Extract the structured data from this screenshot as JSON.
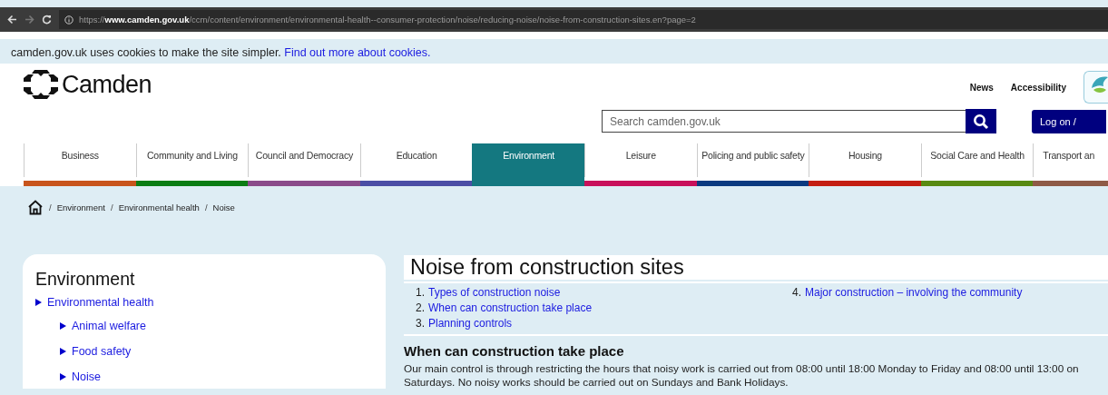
{
  "browser": {
    "url": "https://**www.camden.gov.uk**/ccm/content/environment/environmental-health--consumer-protection/noise/reducing-noise/noise-from-construction-sites.en?page=2"
  },
  "cookie_bar": {
    "text": "camden.gov.uk uses cookies to make the site simpler.",
    "link": "Find out more about cookies."
  },
  "header": {
    "logo": "Camden",
    "links": [
      "News",
      "Accessibility"
    ],
    "search": {
      "placeholder": "Search camden.gov.uk"
    },
    "login": "Log on /"
  },
  "nav": [
    {
      "label": "Business",
      "selected": false,
      "color": "#c8541c"
    },
    {
      "label": "Community and Living",
      "selected": false,
      "color": "#0b7d14"
    },
    {
      "label": "Council and Democracy",
      "selected": false,
      "color": "#8a4b8a"
    },
    {
      "label": "Education",
      "selected": false,
      "color": "#4b4ea5"
    },
    {
      "label": "Environment",
      "selected": true,
      "color": "#147880"
    },
    {
      "label": "Leisure",
      "selected": false,
      "color": "#c8105a"
    },
    {
      "label": "Policing and public safety",
      "selected": false,
      "color": "#0b3a80"
    },
    {
      "label": "Housing",
      "selected": false,
      "color": "#c41e12"
    },
    {
      "label": "Social Care and Health",
      "selected": false,
      "color": "#588a12"
    },
    {
      "label": "Transport an",
      "selected": false,
      "color": "#8e5a46"
    }
  ],
  "breadcrumb": [
    {
      "separator": "/",
      "label": "Environment"
    },
    {
      "separator": "/",
      "label": "Environmental health"
    },
    {
      "separator": "/",
      "label": "Noise"
    }
  ],
  "sidebar": {
    "title": "Environment",
    "items": [
      {
        "label": "Environmental health",
        "children": [
          {
            "label": "Animal welfare"
          },
          {
            "label": "Food safety"
          },
          {
            "label": "Noise"
          }
        ]
      }
    ]
  },
  "article": {
    "title": "Noise from construction sites",
    "contents": [
      {
        "number": "1.",
        "label": "Types of construction noise"
      },
      {
        "number": "2.",
        "label": "When can construction take place"
      },
      {
        "number": "3.",
        "label": "Planning controls"
      },
      {
        "number": "4.",
        "label": "Major construction – involving the community"
      }
    ],
    "heading": "When can construction take place",
    "paragraph": "Our main control is through restricting the hours that noisy work is carried out from 08:00 until 18:00 Monday to Friday and 08:00 until 13:00 on Saturdays. No noisy works should be carried out on Sundays and Bank Holidays."
  }
}
